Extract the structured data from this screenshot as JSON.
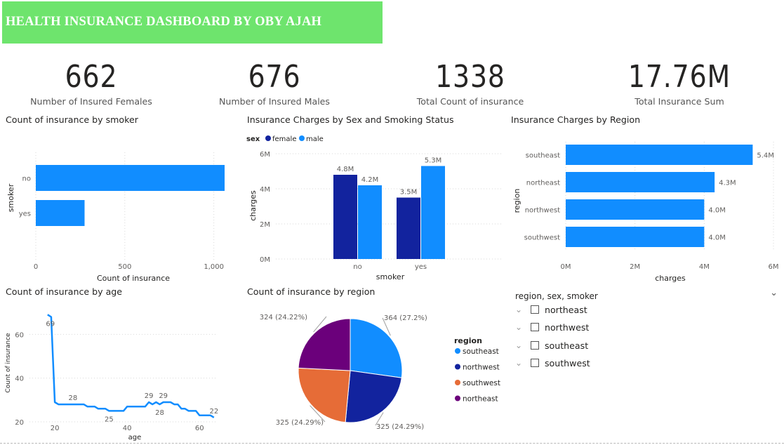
{
  "title": "HEALTH INSURANCE DASHBOARD BY OBY AJAH",
  "kpis": [
    {
      "value": "662",
      "label": "Number of Insured Females"
    },
    {
      "value": "676",
      "label": "Number of Insured Males"
    },
    {
      "value": "1338",
      "label": "Total Count of insurance"
    },
    {
      "value": "17.76M",
      "label": "Total Insurance Sum"
    }
  ],
  "colors": {
    "banner": "#6ee46d",
    "blue": "#118dff",
    "dark_blue": "#12239e",
    "orange": "#e66c37",
    "purple": "#6b007b"
  },
  "chart_data": [
    {
      "id": "smoker_bar",
      "type": "bar",
      "orientation": "horizontal",
      "title": "Count of insurance by smoker",
      "categories": [
        "no",
        "yes"
      ],
      "values": [
        1064,
        274
      ],
      "xlabel": "Count of insurance",
      "ylabel": "smoker",
      "xticks": [
        "0",
        "500",
        "1,000"
      ],
      "xlim": [
        0,
        1100
      ]
    },
    {
      "id": "sex_smoker",
      "type": "bar",
      "title": "Insurance Charges by Sex and Smoking Status",
      "legend_title": "sex",
      "categories": [
        "no",
        "yes"
      ],
      "series": [
        {
          "name": "female",
          "values": [
            4.8,
            3.5
          ],
          "labels": [
            "4.8M",
            "3.5M"
          ]
        },
        {
          "name": "male",
          "values": [
            4.2,
            5.3
          ],
          "labels": [
            "4.2M",
            "5.3M"
          ]
        }
      ],
      "xlabel": "smoker",
      "ylabel": "charges",
      "yticks": [
        "0M",
        "2M",
        "4M",
        "6M"
      ],
      "ylim": [
        0,
        6
      ]
    },
    {
      "id": "region_bar",
      "type": "bar",
      "orientation": "horizontal",
      "title": "Insurance Charges by Region",
      "categories": [
        "southeast",
        "northeast",
        "northwest",
        "southwest"
      ],
      "values": [
        5.4,
        4.3,
        4.0,
        4.0
      ],
      "labels": [
        "5.4M",
        "4.3M",
        "4.0M",
        "4.0M"
      ],
      "xlabel": "charges",
      "ylabel": "region",
      "xticks": [
        "0M",
        "2M",
        "4M",
        "6M"
      ],
      "xlim": [
        0,
        6
      ]
    },
    {
      "id": "age_line",
      "type": "line",
      "title": "Count of insurance by age",
      "x": [
        18,
        19,
        20,
        21,
        22,
        23,
        24,
        25,
        26,
        27,
        28,
        29,
        30,
        31,
        32,
        33,
        34,
        35,
        36,
        37,
        38,
        39,
        40,
        41,
        42,
        43,
        44,
        45,
        46,
        47,
        48,
        49,
        50,
        51,
        52,
        53,
        54,
        55,
        56,
        57,
        58,
        59,
        60,
        61,
        62,
        63,
        64
      ],
      "y": [
        69,
        68,
        29,
        28,
        28,
        28,
        28,
        28,
        28,
        28,
        28,
        27,
        27,
        27,
        26,
        26,
        26,
        25,
        25,
        25,
        25,
        25,
        27,
        27,
        27,
        27,
        27,
        27,
        29,
        28,
        29,
        28,
        29,
        29,
        29,
        28,
        28,
        26,
        26,
        25,
        25,
        25,
        23,
        23,
        23,
        23,
        22
      ],
      "point_labels": [
        {
          "x": 18,
          "text": "69"
        },
        {
          "x": 25,
          "text": "28"
        },
        {
          "x": 35,
          "text": "25"
        },
        {
          "x": 46,
          "text": "29"
        },
        {
          "x": 49,
          "text": "28"
        },
        {
          "x": 50,
          "text": "29"
        },
        {
          "x": 64,
          "text": "22"
        }
      ],
      "xlabel": "age",
      "ylabel": "Count of insurance",
      "xticks": [
        "20",
        "40",
        "60"
      ],
      "yticks": [
        "20",
        "40",
        "60"
      ],
      "xlim": [
        13,
        65
      ],
      "ylim": [
        20,
        72
      ]
    },
    {
      "id": "region_pie",
      "type": "pie",
      "title": "Count of insurance by region",
      "legend_title": "region",
      "categories": [
        "southeast",
        "northwest",
        "southwest",
        "northeast"
      ],
      "values": [
        364,
        325,
        325,
        324
      ],
      "labels": [
        "364 (27.2%)",
        "325 (24.29%)",
        "325 (24.29%)",
        "324 (24.22%)"
      ]
    }
  ],
  "slicer": {
    "title": "region, sex, smoker",
    "items": [
      "northeast",
      "northwest",
      "southeast",
      "southwest"
    ]
  }
}
